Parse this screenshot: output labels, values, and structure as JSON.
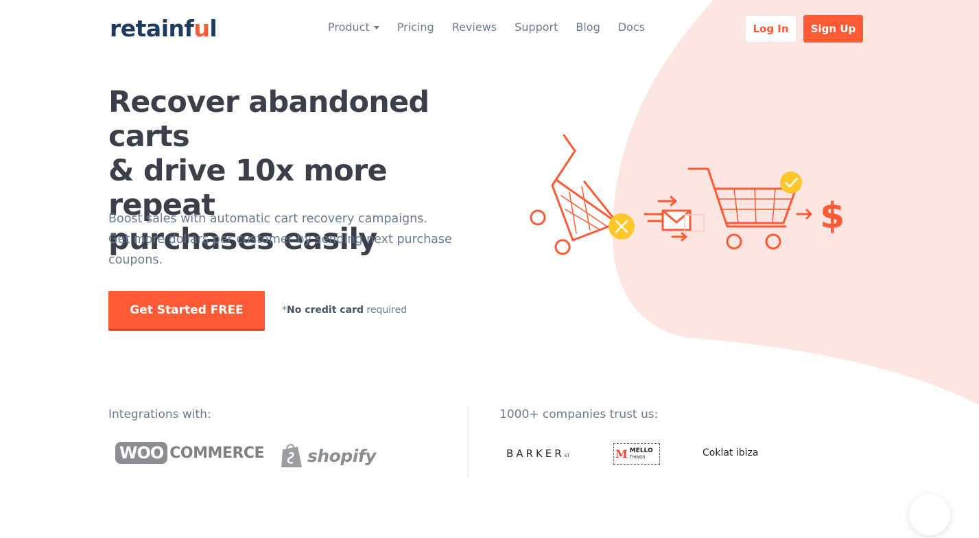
{
  "brand": {
    "logo_main": "retainf",
    "logo_accent": "u",
    "logo_end": "l",
    "accent_color": "#ff5a36",
    "blob_color": "#fde6e2"
  },
  "nav": {
    "items": [
      {
        "label": "Product",
        "has_dropdown": true
      },
      {
        "label": "Pricing"
      },
      {
        "label": "Reviews"
      },
      {
        "label": "Support"
      },
      {
        "label": "Blog"
      },
      {
        "label": "Docs"
      }
    ]
  },
  "auth": {
    "login_label": "Log In",
    "signup_label": "Sign Up"
  },
  "hero": {
    "headline_1": "Recover abandoned carts",
    "headline_2": "& drive 10x more repeat",
    "headline_3": "purchases easily",
    "sub_1": "Boost sales with automatic cart recovery campaigns.",
    "sub_2": "Get more dollars per customer by sending next purchase",
    "sub_3": "coupons.",
    "cta_label": "Get Started FREE",
    "note_prefix": "*",
    "note_bold": "No credit card",
    "note_suffix": " required"
  },
  "integrations": {
    "title": "Integrations with:",
    "woo_bubble": "WOO",
    "woo_text": "COMMERCE",
    "shopify_text": "shopify"
  },
  "trust": {
    "title": "1000+ companies trust us:",
    "barker": "BARKER",
    "barker_suffix": "ST",
    "mello_mark": "M",
    "mello_name": "MELLO",
    "mello_sub": "THINGS",
    "coklat": "Coklat ibiza"
  },
  "illustration": {
    "dollar": "$"
  }
}
